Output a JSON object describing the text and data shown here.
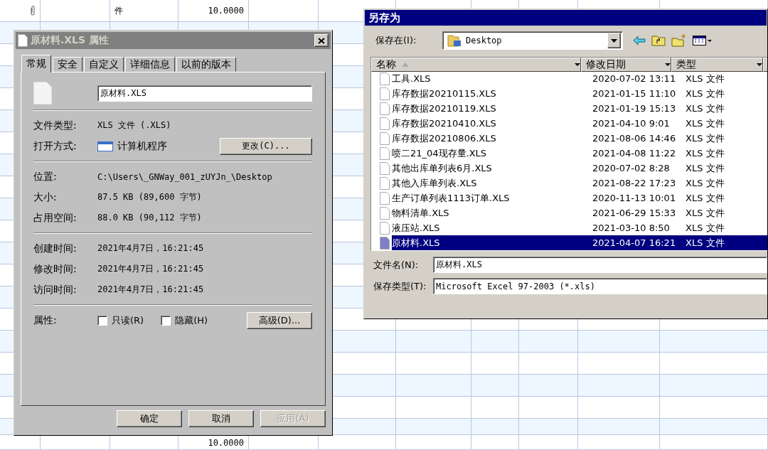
{
  "spreadsheet": {
    "top_row": {
      "cell_3": "件",
      "cell_4": "10.0000"
    },
    "bottom_row": {
      "cell_4": "10.0000"
    }
  },
  "properties_dialog": {
    "title": "原材料.XLS 属性",
    "tabs": [
      {
        "label": "常规",
        "selected": true
      },
      {
        "label": "安全",
        "selected": false
      },
      {
        "label": "自定义",
        "selected": false
      },
      {
        "label": "详细信息",
        "selected": false
      },
      {
        "label": "以前的版本",
        "selected": false
      }
    ],
    "file_name": "原材料.XLS",
    "sections": [
      [
        {
          "label": "文件类型:",
          "value": "XLS 文件 (.XLS)"
        },
        {
          "label": "打开方式:",
          "value": "计算机程序",
          "button": "更改(C)..."
        }
      ],
      [
        {
          "label": "位置:",
          "value": "C:\\Users\\_GNWay_001_zUYJn_\\Desktop"
        },
        {
          "label": "大小:",
          "value": "87.5 KB (89,600 字节)"
        },
        {
          "label": "占用空间:",
          "value": "88.0 KB (90,112 字节)"
        }
      ],
      [
        {
          "label": "创建时间:",
          "value": "2021年4月7日，16:21:45"
        },
        {
          "label": "修改时间:",
          "value": "2021年4月7日，16:21:45"
        },
        {
          "label": "访问时间:",
          "value": "2021年4月7日，16:21:45"
        }
      ]
    ],
    "attributes_label": "属性:",
    "attributes": [
      {
        "label": "只读(R)",
        "checked": false
      },
      {
        "label": "隐藏(H)",
        "checked": false
      }
    ],
    "advanced_button": "高级(D)...",
    "buttons": [
      {
        "label": "确定",
        "disabled": false
      },
      {
        "label": "取消",
        "disabled": false
      },
      {
        "label": "应用(A)",
        "disabled": true
      }
    ]
  },
  "save_as_dialog": {
    "title": "另存为",
    "save_in": {
      "label": "保存在(I):",
      "value": "Desktop"
    },
    "columns": [
      "名称",
      "修改日期",
      "类型"
    ],
    "files": [
      {
        "name": "工具.XLS",
        "modified": "2020-07-02 13:11",
        "type": "XLS 文件",
        "selected": false
      },
      {
        "name": "库存数据20210115.XLS",
        "modified": "2021-01-15 11:10",
        "type": "XLS 文件",
        "selected": false
      },
      {
        "name": "库存数据20210119.XLS",
        "modified": "2021-01-19 15:13",
        "type": "XLS 文件",
        "selected": false
      },
      {
        "name": "库存数据20210410.XLS",
        "modified": "2021-04-10 9:01",
        "type": "XLS 文件",
        "selected": false
      },
      {
        "name": "库存数据20210806.XLS",
        "modified": "2021-08-06 14:46",
        "type": "XLS 文件",
        "selected": false
      },
      {
        "name": "喷二21_04现存量.XLS",
        "modified": "2021-04-08 11:22",
        "type": "XLS 文件",
        "selected": false
      },
      {
        "name": "其他出库单列表6月.XLS",
        "modified": "2020-07-02 8:28",
        "type": "XLS 文件",
        "selected": false
      },
      {
        "name": "其他入库单列表.XLS",
        "modified": "2021-08-22 17:23",
        "type": "XLS 文件",
        "selected": false
      },
      {
        "name": "生产订单列表1113订单.XLS",
        "modified": "2020-11-13 10:01",
        "type": "XLS 文件",
        "selected": false
      },
      {
        "name": "物料清单.XLS",
        "modified": "2021-06-29 15:33",
        "type": "XLS 文件",
        "selected": false
      },
      {
        "name": "液压站.XLS",
        "modified": "2021-03-10 8:50",
        "type": "XLS 文件",
        "selected": false
      },
      {
        "name": "原材料.XLS",
        "modified": "2021-04-07 16:21",
        "type": "XLS 文件",
        "selected": true
      }
    ],
    "file_name": {
      "label": "文件名(N):",
      "value": "原材料.XLS"
    },
    "save_type": {
      "label": "保存类型(T):",
      "value": "Microsoft Excel 97-2003 (*.xls)"
    }
  }
}
